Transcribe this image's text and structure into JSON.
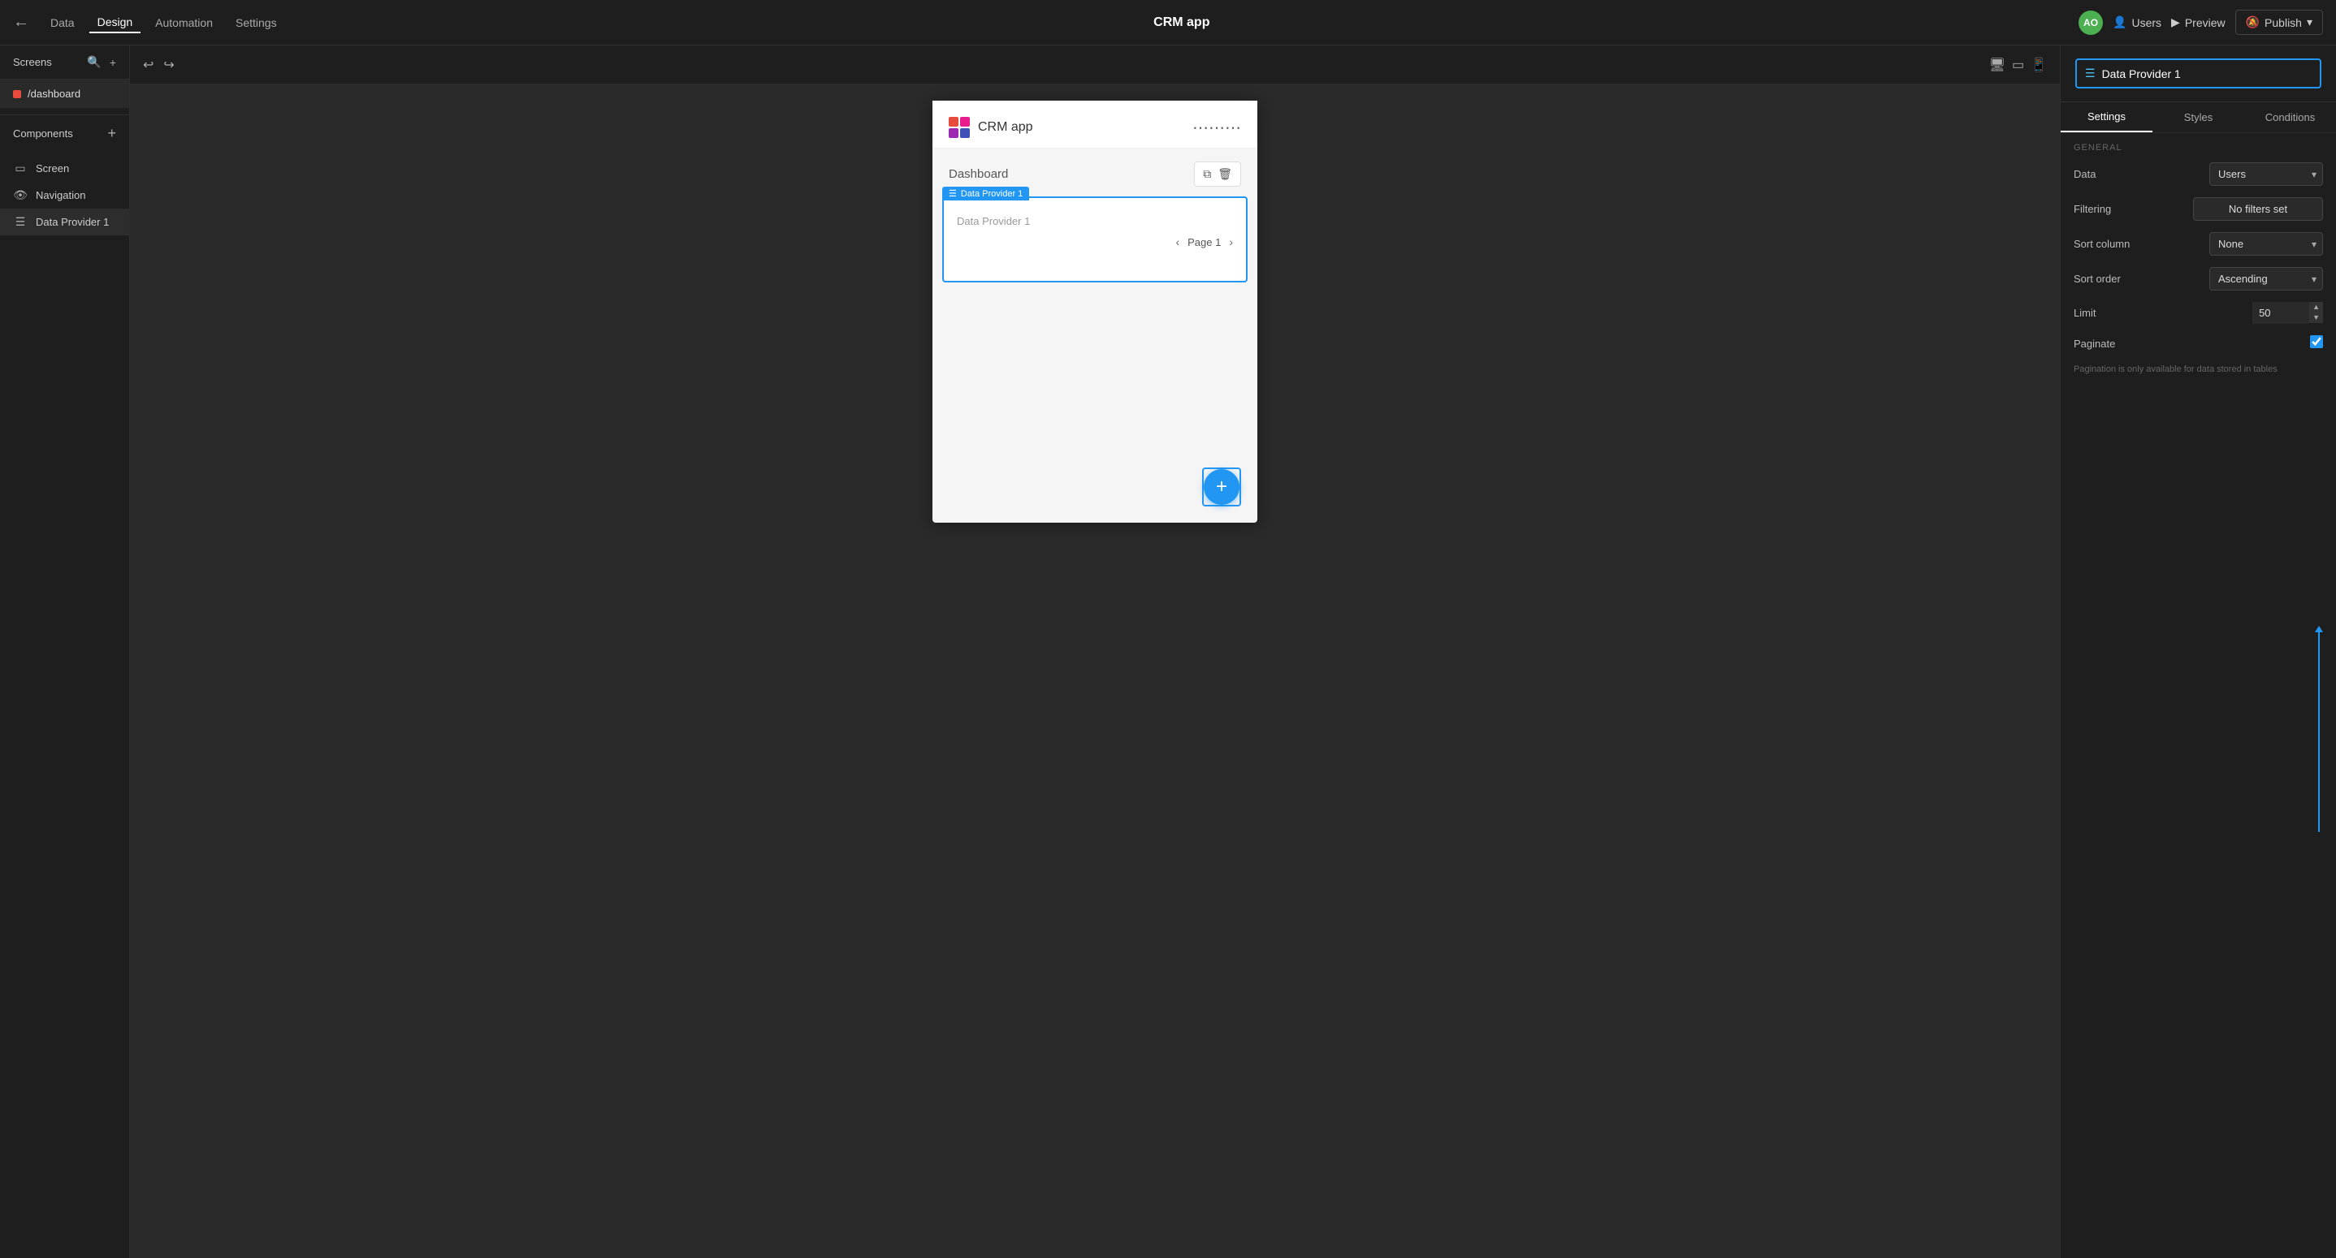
{
  "topNav": {
    "backLabel": "←",
    "dataLabel": "Data",
    "designLabel": "Design",
    "automationLabel": "Automation",
    "settingsLabel": "Settings",
    "appTitle": "CRM app",
    "avatarInitials": "AO",
    "usersLabel": "Users",
    "previewLabel": "Preview",
    "publishLabel": "Publish"
  },
  "leftPanel": {
    "screensTitle": "Screens",
    "searchIcon": "🔍",
    "addIcon": "+",
    "screenItem": "/dashboard",
    "componentsTitle": "Components",
    "components": [
      {
        "name": "Screen",
        "icon": "▭"
      },
      {
        "name": "Navigation",
        "icon": "👁"
      },
      {
        "name": "Data Provider 1",
        "icon": "☰"
      }
    ]
  },
  "canvas": {
    "undoIcon": "↩",
    "redoIcon": "↪",
    "desktopIcon": "🖥",
    "tabletIcon": "▭",
    "mobileIcon": "📱",
    "appName": "CRM app",
    "dashboardLabel": "Dashboard",
    "dataProviderTag": "Data Provider 1",
    "dataProviderLabel": "Data Provider 1",
    "pageLabel": "Page 1",
    "fabIcon": "+"
  },
  "rightPanel": {
    "headerTitle": "Data Provider 1",
    "headerIcon": "☰",
    "tabs": [
      "Settings",
      "Styles",
      "Conditions"
    ],
    "activeTab": "Settings",
    "general": {
      "sectionTitle": "GENERAL",
      "dataLabel": "Data",
      "dataValue": "Users",
      "filteringLabel": "Filtering",
      "filteringValue": "No filters set",
      "sortColumnLabel": "Sort column",
      "sortColumnValue": "None",
      "sortOrderLabel": "Sort order",
      "sortOrderValue": "Ascending",
      "limitLabel": "Limit",
      "limitValue": "50",
      "paginateLabel": "Paginate",
      "paginateNote": "Pagination is only available for data stored in tables",
      "paginateChecked": true
    }
  }
}
